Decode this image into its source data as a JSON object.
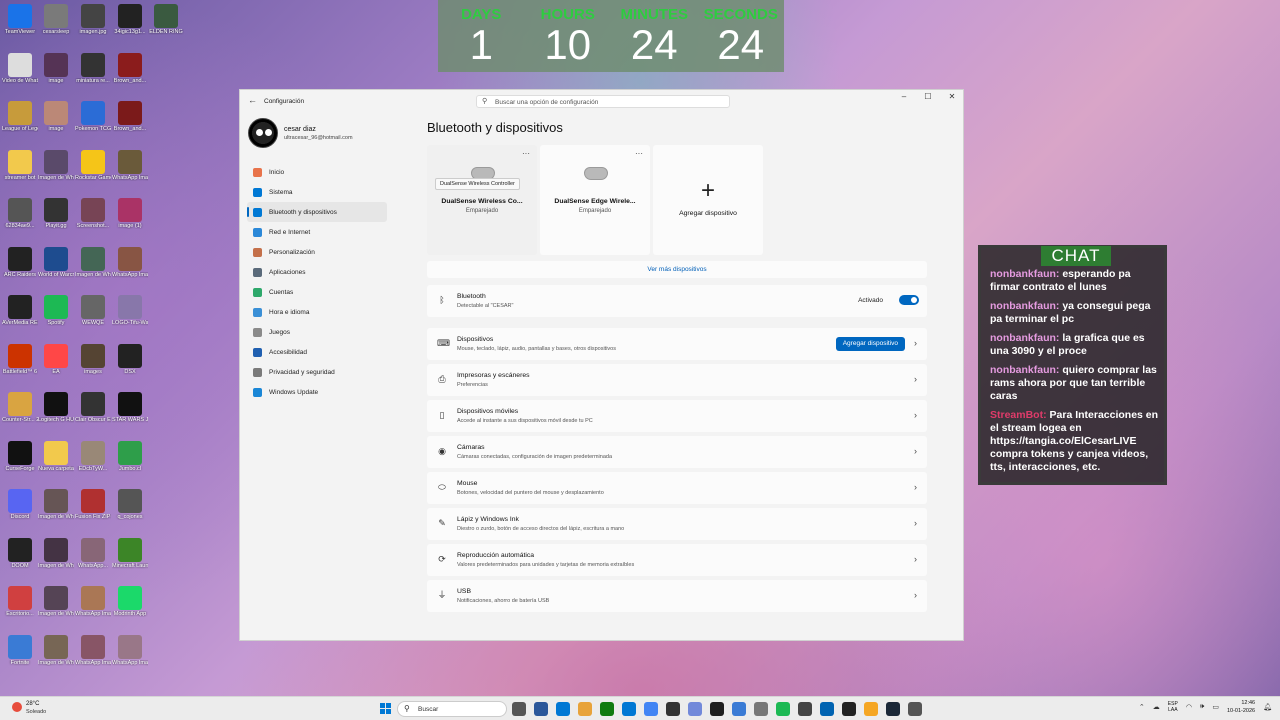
{
  "desktop": {
    "icons": [
      {
        "label": "TeamViewer",
        "color": "#1a73e8"
      },
      {
        "label": "cesarsleep",
        "color": "#7a7a7a"
      },
      {
        "label": "imagen.jpg",
        "color": "#444444"
      },
      {
        "label": "34igic13g1...",
        "color": "#222222"
      },
      {
        "label": "ELDEN RING",
        "color": "#3a5a40"
      },
      {
        "label": "Video de WhatsApp...",
        "color": "#dddddd"
      },
      {
        "label": "image",
        "color": "#553355"
      },
      {
        "label": "miniatura re...",
        "color": "#333333"
      },
      {
        "label": "Brown_and...",
        "color": "#8b1c1c"
      },
      {
        "label": "League of Legends",
        "color": "#c79b3b"
      },
      {
        "label": "image",
        "color": "#bb8877"
      },
      {
        "label": "Pokemon TCG Live",
        "color": "#2b6cd6"
      },
      {
        "label": "Brown_and...",
        "color": "#7b1a1a"
      },
      {
        "label": "streamer bot",
        "color": "#f2c94c"
      },
      {
        "label": "Imagen de WhatsApp...",
        "color": "#5a4a6a"
      },
      {
        "label": "Rockstar Games...",
        "color": "#f5c518"
      },
      {
        "label": "WhatsApp Image 2025...",
        "color": "#6a5a3a"
      },
      {
        "label": "62834ae9...",
        "color": "#555555"
      },
      {
        "label": "Playit.gg",
        "color": "#333333"
      },
      {
        "label": "Screenshot...",
        "color": "#774455"
      },
      {
        "label": "image (1)",
        "color": "#aa3366"
      },
      {
        "label": "ARC Raiders",
        "color": "#222222"
      },
      {
        "label": "World of Warcraft",
        "color": "#1e4c8f"
      },
      {
        "label": "Imagen de WhatsApp...",
        "color": "#446655"
      },
      {
        "label": "WhatsApp Image 2025...",
        "color": "#885544"
      },
      {
        "label": "AVerMedia RECentral 4",
        "color": "#222222"
      },
      {
        "label": "Spotify",
        "color": "#1db954"
      },
      {
        "label": "WEWQE",
        "color": "#666666"
      },
      {
        "label": "LOGO-Tifu-Warm-Ca...",
        "color": "#8877aa"
      },
      {
        "label": "Battlefield™ 6",
        "color": "#cc3300"
      },
      {
        "label": "EA",
        "color": "#ff4747"
      },
      {
        "label": "images",
        "color": "#554433"
      },
      {
        "label": "DSX",
        "color": "#222222"
      },
      {
        "label": "Counter-Str... 2",
        "color": "#d9a441"
      },
      {
        "label": "Logitech G HUB",
        "color": "#111111"
      },
      {
        "label": "Clair Obscur Expedition 33",
        "color": "#333333"
      },
      {
        "label": "STAR WARS Jedi - La ...",
        "color": "#111111"
      },
      {
        "label": "CurseForge",
        "color": "#111111"
      },
      {
        "label": "Nueva carpeta",
        "color": "#f2c94c"
      },
      {
        "label": "EDcbTyW...",
        "color": "#998877"
      },
      {
        "label": "Jumbo.cl",
        "color": "#2e9e4a"
      },
      {
        "label": "Discord",
        "color": "#5865f2"
      },
      {
        "label": "Imagen de WhatsApp...",
        "color": "#665555"
      },
      {
        "label": "Fusion Fix ZIP-716-4-0...",
        "color": "#b03030"
      },
      {
        "label": "q_cojones",
        "color": "#555555"
      },
      {
        "label": "DOOM",
        "color": "#222222"
      },
      {
        "label": "Imagen de WhatsApp...",
        "color": "#443344"
      },
      {
        "label": "WhatsApp...",
        "color": "#886677"
      },
      {
        "label": "Minecraft Launcher",
        "color": "#3c8527"
      },
      {
        "label": "Escritorio...",
        "color": "#d04040"
      },
      {
        "label": "Imagen de WhatsApp...",
        "color": "#554455"
      },
      {
        "label": "WhatsApp Image 2025...",
        "color": "#aa7755"
      },
      {
        "label": "Modrinth App",
        "color": "#1bd96a"
      },
      {
        "label": "Fortnite",
        "color": "#3a7bd5"
      },
      {
        "label": "Imagen de WhatsApp...",
        "color": "#776655"
      },
      {
        "label": "WhatsApp Image 2025...",
        "color": "#885566"
      },
      {
        "label": "WhatsApp Image 2026...",
        "color": "#997788"
      }
    ]
  },
  "countdown": {
    "cells": [
      {
        "label": "DAYS",
        "value": "1"
      },
      {
        "label": "HOURS",
        "value": "10"
      },
      {
        "label": "MINUTES",
        "value": "24"
      },
      {
        "label": "SECONDS",
        "value": "24"
      }
    ]
  },
  "settings": {
    "window_title": "Configuración",
    "search_placeholder": "Buscar una opción de configuración",
    "profile": {
      "name": "cesar diaz",
      "email": "ultracesar_96@hotmail.com"
    },
    "nav": [
      {
        "label": "Inicio",
        "color": "#e8734a"
      },
      {
        "label": "Sistema",
        "color": "#0078d4"
      },
      {
        "label": "Bluetooth y dispositivos",
        "color": "#0078d4"
      },
      {
        "label": "Red e Internet",
        "color": "#2b88d8"
      },
      {
        "label": "Personalización",
        "color": "#c4704a"
      },
      {
        "label": "Aplicaciones",
        "color": "#5a6a7a"
      },
      {
        "label": "Cuentas",
        "color": "#2ea86b"
      },
      {
        "label": "Hora e idioma",
        "color": "#3a8fd6"
      },
      {
        "label": "Juegos",
        "color": "#8a8a8a"
      },
      {
        "label": "Accesibilidad",
        "color": "#1f5fb0"
      },
      {
        "label": "Privacidad y seguridad",
        "color": "#7a7a7a"
      },
      {
        "label": "Windows Update",
        "color": "#1a86d6"
      }
    ],
    "page_title": "Bluetooth y dispositivos",
    "devices": [
      {
        "name": "DualSense Wireless Co...",
        "status": "Emparejado",
        "tooltip": "DualSense Wireless Controller"
      },
      {
        "name": "DualSense Edge Wirele...",
        "status": "Emparejado"
      }
    ],
    "add_device_card": "Agregar dispositivo",
    "more_devices": "Ver más dispositivos",
    "bluetooth": {
      "title": "Bluetooth",
      "subtitle": "Detectable al \"CESAR\"",
      "state": "Activado"
    },
    "rows": [
      {
        "title": "Dispositivos",
        "subtitle": "Mouse, teclado, lápiz, audio, pantallas y bases, otros dispositivos",
        "icon": "⌨",
        "button": "Agregar dispositivo"
      },
      {
        "title": "Impresoras y escáneres",
        "subtitle": "Preferencias",
        "icon": "⎙"
      },
      {
        "title": "Dispositivos móviles",
        "subtitle": "Accede al instante a sus dispositivos móvil desde tu PC",
        "icon": "▯"
      },
      {
        "title": "Cámaras",
        "subtitle": "Cámaras conectadas, configuración de imagen predeterminada",
        "icon": "◉"
      },
      {
        "title": "Mouse",
        "subtitle": "Botones, velocidad del puntero del mouse y desplazamiento",
        "icon": "⬭"
      },
      {
        "title": "Lápiz y Windows Ink",
        "subtitle": "Diestro o zurdo, botón de acceso directos del lápiz, escritura a mano",
        "icon": "✎"
      },
      {
        "title": "Reproducción automática",
        "subtitle": "Valores predeterminados para unidades y tarjetas de memoria extraíbles",
        "icon": "⟳"
      },
      {
        "title": "USB",
        "subtitle": "Notificaciones, ahorro de batería USB",
        "icon": "⏚"
      }
    ]
  },
  "chat": {
    "title": "CHAT",
    "messages": [
      {
        "user": "nonbankfaun:",
        "text": " esperando pa firmar contrato el lunes"
      },
      {
        "user": "nonbankfaun:",
        "text": " ya consegui pega pa terminar el pc"
      },
      {
        "user": "nonbankfaun:",
        "text": " la grafica que es una 3090 y el proce"
      },
      {
        "user": "nonbankfaun:",
        "text": " quiero comprar las rams ahora por que tan terrible caras"
      },
      {
        "user": "StreamBot:",
        "text": " Para Interacciones en el stream logea en https://tangia.co/ElCesarLIVE compra tokens y canjea videos, tts, interacciones, etc.",
        "bot": true
      }
    ]
  },
  "taskbar": {
    "weather_temp": "28°C",
    "weather_desc": "Soleado",
    "search_label": "Buscar",
    "lang_1": "ESP",
    "lang_2": "LAA",
    "time": "12:46",
    "date": "10-01-2026",
    "apps": [
      "#555555",
      "#2b579a",
      "#0078d4",
      "#e8a33a",
      "#0f7b0f",
      "#0078d4",
      "#4285f4",
      "#333333",
      "#7289da",
      "#1f1f1f",
      "#3a7bd5",
      "#777777",
      "#1db954",
      "#444444",
      "#0063b1",
      "#222222",
      "#f5a623",
      "#1b2838",
      "#555555"
    ]
  }
}
